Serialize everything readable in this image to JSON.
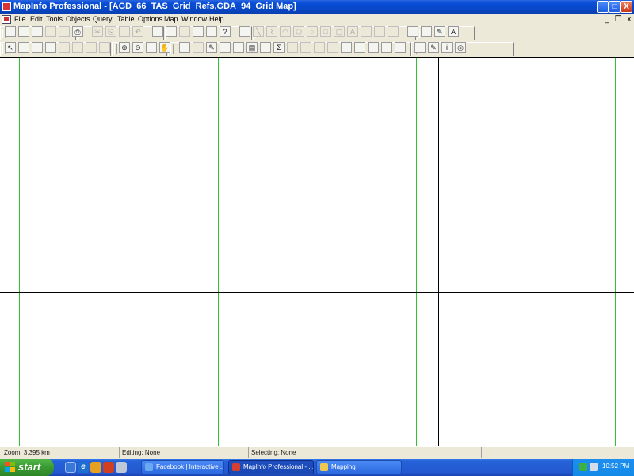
{
  "window": {
    "title": "MapInfo Professional - [AGD_66_TAS_Grid_Refs,GDA_94_Grid Map]",
    "controls": {
      "minimize": "_",
      "maximize": "□",
      "close": "X"
    }
  },
  "menubar": {
    "items": [
      "File",
      "Edit",
      "Tools",
      "Objects",
      "Query",
      "Table",
      "Options",
      "Map",
      "Window",
      "Help"
    ],
    "mdi_controls": {
      "minimize": "_",
      "restore": "❐",
      "close": "x"
    }
  },
  "toolbars": {
    "row1_icons": [
      "new-table-icon",
      "open-table-icon",
      "open-workspace-icon",
      "save-table-icon",
      "save-copy-icon",
      "print-icon",
      "cut-icon",
      "copy-icon",
      "paste-icon",
      "undo-icon",
      "new-browser-icon",
      "new-mapper-icon",
      "new-grapher-icon",
      "new-layout-icon",
      "new-redistrict-icon",
      "help-icon",
      "symbol-icon",
      "line-icon",
      "polyline-icon",
      "arc-icon",
      "polygon-icon",
      "ellipse-icon",
      "rectangle-icon",
      "rounded-rect-icon",
      "text-icon",
      "frame-icon",
      "reshape-icon",
      "add-node-icon",
      "mapbasic-icon",
      "tools-icon",
      "styles-icon",
      "text-style-icon"
    ],
    "row2_icons": [
      "select-icon",
      "marquee-select-icon",
      "radius-select-icon",
      "polygon-select-icon",
      "boundary-select-icon",
      "unselect-icon",
      "invert-select-icon",
      "graph-select-icon",
      "zoom-in-icon",
      "zoom-out-icon",
      "change-view-icon",
      "grabber-icon",
      "info-icon",
      "hotlink-icon",
      "label-icon",
      "drag-window-icon",
      "layer-control-icon",
      "ruler-icon",
      "legend-icon",
      "statistics-icon",
      "clip-region-icon",
      "set-target-icon",
      "combine-icon",
      "split-icon",
      "thematic-icon",
      "create-legend-icon",
      "overlay-icon",
      "distance-icon",
      "scale-bar-icon",
      "edit-icon",
      "pencil-icon",
      "info-tool-icon",
      "globe-icon"
    ],
    "row2_text": {
      "info": "i",
      "statistics": "Σ"
    }
  },
  "status": {
    "zoom": "Zoom: 3.395 km",
    "editing": "Editing: None",
    "selecting": "Selecting: None"
  },
  "taskbar": {
    "start_label": "start",
    "buttons": [
      {
        "label": "Facebook | Interactive ...",
        "active": false
      },
      {
        "label": "MapInfo Professional - ...",
        "active": true
      },
      {
        "label": "Mapping",
        "active": false
      }
    ],
    "clock": "10:52 PM"
  },
  "colors": {
    "grid_line": "#2fc22f",
    "border_line": "#000000",
    "title_bar": "#0a4fd8",
    "taskbar": "#2458d0",
    "start_button": "#3a9a32"
  }
}
